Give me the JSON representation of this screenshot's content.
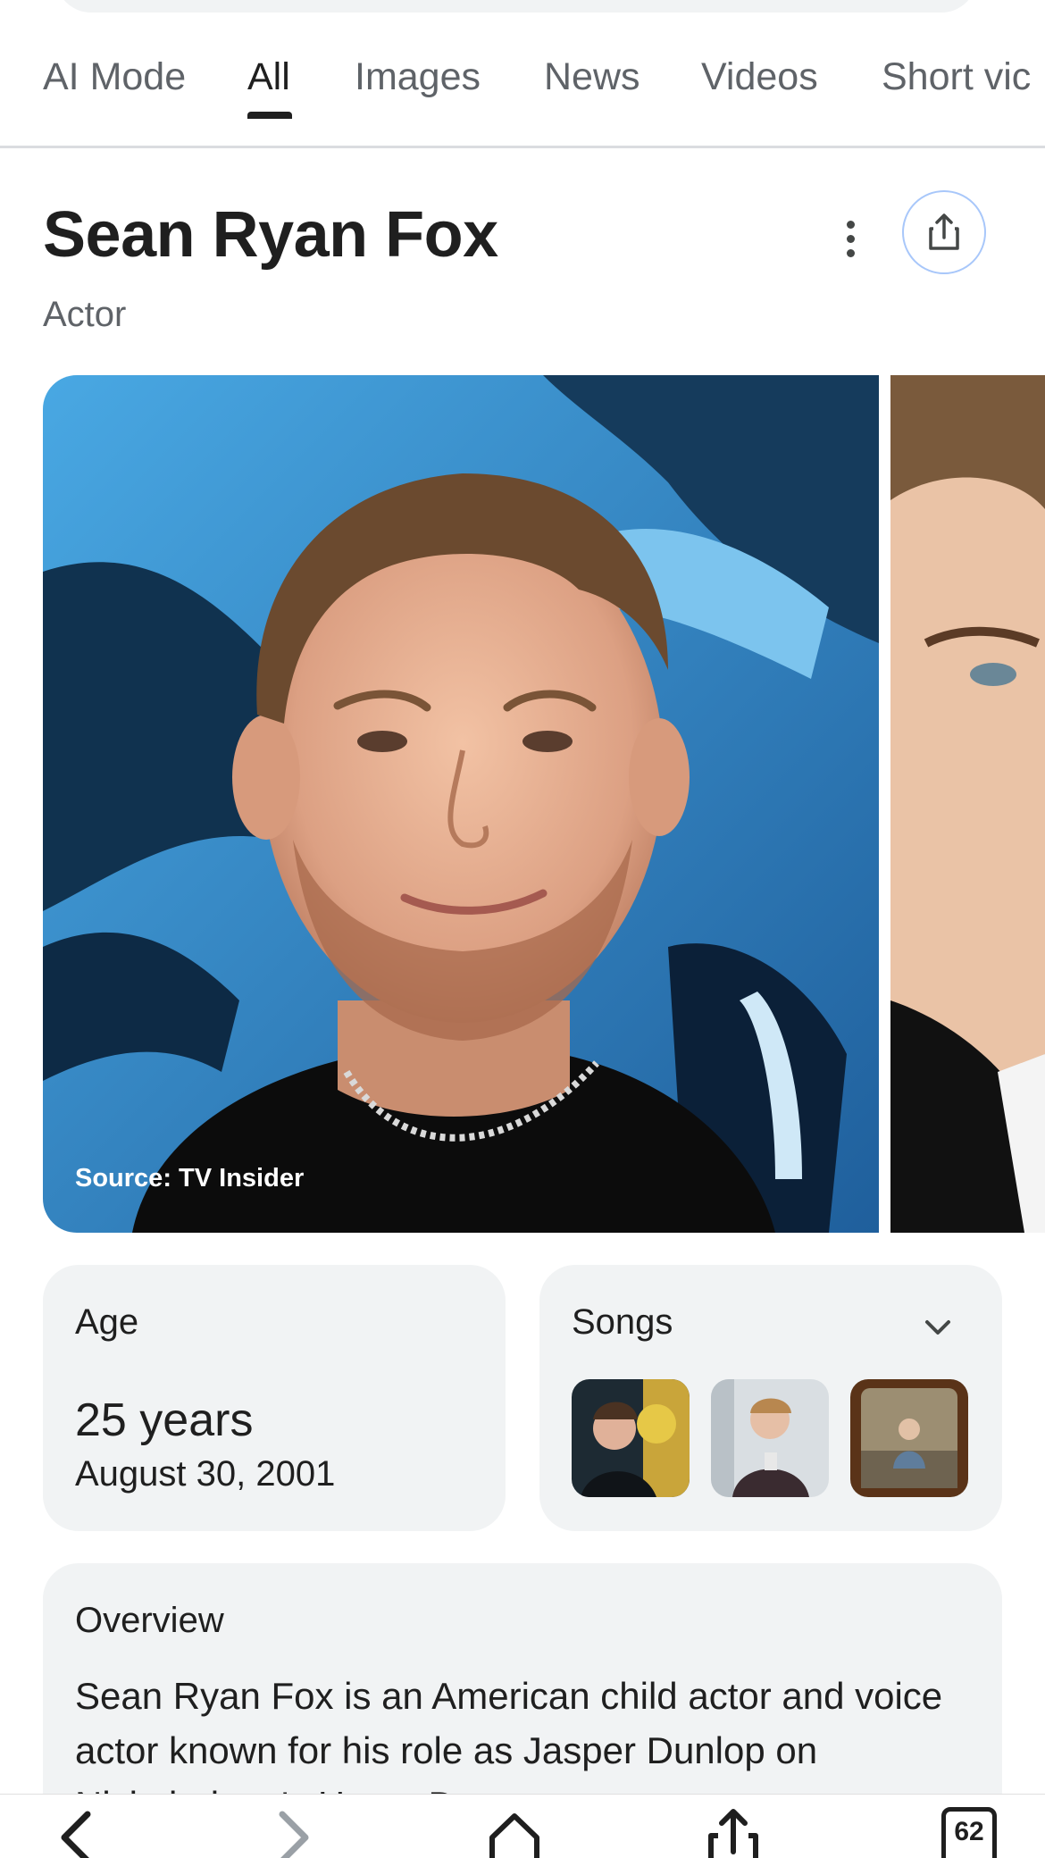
{
  "tabs": [
    {
      "label": "AI Mode",
      "active": false
    },
    {
      "label": "All",
      "active": true
    },
    {
      "label": "Images",
      "active": false
    },
    {
      "label": "News",
      "active": false
    },
    {
      "label": "Videos",
      "active": false
    },
    {
      "label": "Short vic",
      "active": false
    }
  ],
  "entity": {
    "name": "Sean Ryan Fox",
    "type": "Actor"
  },
  "images": {
    "source": "Source: TV Insider"
  },
  "age_card": {
    "label": "Age",
    "value": "25 years",
    "date": "August 30, 2001"
  },
  "songs_card": {
    "label": "Songs",
    "thumbnail_count": 3
  },
  "overview": {
    "label": "Overview",
    "text": "Sean Ryan Fox is an American child actor and voice actor known for his role as Jasper Dunlop on Nickelodeon's Henry Danger."
  },
  "bottom_nav": {
    "tabs_count": "62",
    "icons": [
      "back-icon",
      "forward-icon",
      "home-icon",
      "share-icon",
      "tabs-icon"
    ]
  },
  "colors": {
    "accent_border": "#a8c7fa",
    "card_bg": "#f1f3f4",
    "muted_text": "#5f6368"
  }
}
